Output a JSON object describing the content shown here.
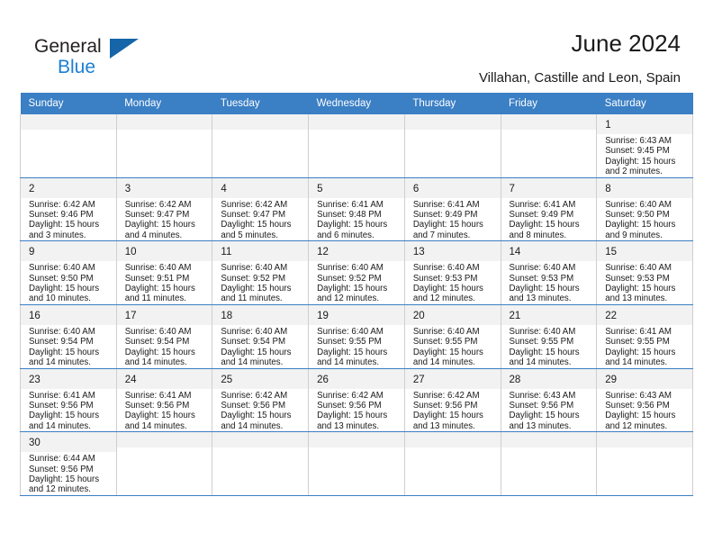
{
  "brand": {
    "name_top": "General",
    "name_bottom": "Blue",
    "accent_color": "#1b7fd4",
    "logo_triangle_color": "#1565a8"
  },
  "header": {
    "title": "June 2024",
    "subtitle": "Villahan, Castille and Leon, Spain"
  },
  "theme": {
    "header_row_bg": "#3b7fc4",
    "day_number_bg": "#f2f2f2",
    "grid_line": "#cfcfcf"
  },
  "weekdays": [
    "Sunday",
    "Monday",
    "Tuesday",
    "Wednesday",
    "Thursday",
    "Friday",
    "Saturday"
  ],
  "weeks": [
    [
      {
        "day": "",
        "sunrise": "",
        "sunset": "",
        "daylight": "",
        "empty": true
      },
      {
        "day": "",
        "sunrise": "",
        "sunset": "",
        "daylight": "",
        "empty": true
      },
      {
        "day": "",
        "sunrise": "",
        "sunset": "",
        "daylight": "",
        "empty": true
      },
      {
        "day": "",
        "sunrise": "",
        "sunset": "",
        "daylight": "",
        "empty": true
      },
      {
        "day": "",
        "sunrise": "",
        "sunset": "",
        "daylight": "",
        "empty": true
      },
      {
        "day": "",
        "sunrise": "",
        "sunset": "",
        "daylight": "",
        "empty": true
      },
      {
        "day": "1",
        "sunrise": "Sunrise: 6:43 AM",
        "sunset": "Sunset: 9:45 PM",
        "daylight": "Daylight: 15 hours and 2 minutes.",
        "empty": false
      }
    ],
    [
      {
        "day": "2",
        "sunrise": "Sunrise: 6:42 AM",
        "sunset": "Sunset: 9:46 PM",
        "daylight": "Daylight: 15 hours and 3 minutes.",
        "empty": false
      },
      {
        "day": "3",
        "sunrise": "Sunrise: 6:42 AM",
        "sunset": "Sunset: 9:47 PM",
        "daylight": "Daylight: 15 hours and 4 minutes.",
        "empty": false
      },
      {
        "day": "4",
        "sunrise": "Sunrise: 6:42 AM",
        "sunset": "Sunset: 9:47 PM",
        "daylight": "Daylight: 15 hours and 5 minutes.",
        "empty": false
      },
      {
        "day": "5",
        "sunrise": "Sunrise: 6:41 AM",
        "sunset": "Sunset: 9:48 PM",
        "daylight": "Daylight: 15 hours and 6 minutes.",
        "empty": false
      },
      {
        "day": "6",
        "sunrise": "Sunrise: 6:41 AM",
        "sunset": "Sunset: 9:49 PM",
        "daylight": "Daylight: 15 hours and 7 minutes.",
        "empty": false
      },
      {
        "day": "7",
        "sunrise": "Sunrise: 6:41 AM",
        "sunset": "Sunset: 9:49 PM",
        "daylight": "Daylight: 15 hours and 8 minutes.",
        "empty": false
      },
      {
        "day": "8",
        "sunrise": "Sunrise: 6:40 AM",
        "sunset": "Sunset: 9:50 PM",
        "daylight": "Daylight: 15 hours and 9 minutes.",
        "empty": false
      }
    ],
    [
      {
        "day": "9",
        "sunrise": "Sunrise: 6:40 AM",
        "sunset": "Sunset: 9:50 PM",
        "daylight": "Daylight: 15 hours and 10 minutes.",
        "empty": false
      },
      {
        "day": "10",
        "sunrise": "Sunrise: 6:40 AM",
        "sunset": "Sunset: 9:51 PM",
        "daylight": "Daylight: 15 hours and 11 minutes.",
        "empty": false
      },
      {
        "day": "11",
        "sunrise": "Sunrise: 6:40 AM",
        "sunset": "Sunset: 9:52 PM",
        "daylight": "Daylight: 15 hours and 11 minutes.",
        "empty": false
      },
      {
        "day": "12",
        "sunrise": "Sunrise: 6:40 AM",
        "sunset": "Sunset: 9:52 PM",
        "daylight": "Daylight: 15 hours and 12 minutes.",
        "empty": false
      },
      {
        "day": "13",
        "sunrise": "Sunrise: 6:40 AM",
        "sunset": "Sunset: 9:53 PM",
        "daylight": "Daylight: 15 hours and 12 minutes.",
        "empty": false
      },
      {
        "day": "14",
        "sunrise": "Sunrise: 6:40 AM",
        "sunset": "Sunset: 9:53 PM",
        "daylight": "Daylight: 15 hours and 13 minutes.",
        "empty": false
      },
      {
        "day": "15",
        "sunrise": "Sunrise: 6:40 AM",
        "sunset": "Sunset: 9:53 PM",
        "daylight": "Daylight: 15 hours and 13 minutes.",
        "empty": false
      }
    ],
    [
      {
        "day": "16",
        "sunrise": "Sunrise: 6:40 AM",
        "sunset": "Sunset: 9:54 PM",
        "daylight": "Daylight: 15 hours and 14 minutes.",
        "empty": false
      },
      {
        "day": "17",
        "sunrise": "Sunrise: 6:40 AM",
        "sunset": "Sunset: 9:54 PM",
        "daylight": "Daylight: 15 hours and 14 minutes.",
        "empty": false
      },
      {
        "day": "18",
        "sunrise": "Sunrise: 6:40 AM",
        "sunset": "Sunset: 9:54 PM",
        "daylight": "Daylight: 15 hours and 14 minutes.",
        "empty": false
      },
      {
        "day": "19",
        "sunrise": "Sunrise: 6:40 AM",
        "sunset": "Sunset: 9:55 PM",
        "daylight": "Daylight: 15 hours and 14 minutes.",
        "empty": false
      },
      {
        "day": "20",
        "sunrise": "Sunrise: 6:40 AM",
        "sunset": "Sunset: 9:55 PM",
        "daylight": "Daylight: 15 hours and 14 minutes.",
        "empty": false
      },
      {
        "day": "21",
        "sunrise": "Sunrise: 6:40 AM",
        "sunset": "Sunset: 9:55 PM",
        "daylight": "Daylight: 15 hours and 14 minutes.",
        "empty": false
      },
      {
        "day": "22",
        "sunrise": "Sunrise: 6:41 AM",
        "sunset": "Sunset: 9:55 PM",
        "daylight": "Daylight: 15 hours and 14 minutes.",
        "empty": false
      }
    ],
    [
      {
        "day": "23",
        "sunrise": "Sunrise: 6:41 AM",
        "sunset": "Sunset: 9:56 PM",
        "daylight": "Daylight: 15 hours and 14 minutes.",
        "empty": false
      },
      {
        "day": "24",
        "sunrise": "Sunrise: 6:41 AM",
        "sunset": "Sunset: 9:56 PM",
        "daylight": "Daylight: 15 hours and 14 minutes.",
        "empty": false
      },
      {
        "day": "25",
        "sunrise": "Sunrise: 6:42 AM",
        "sunset": "Sunset: 9:56 PM",
        "daylight": "Daylight: 15 hours and 14 minutes.",
        "empty": false
      },
      {
        "day": "26",
        "sunrise": "Sunrise: 6:42 AM",
        "sunset": "Sunset: 9:56 PM",
        "daylight": "Daylight: 15 hours and 13 minutes.",
        "empty": false
      },
      {
        "day": "27",
        "sunrise": "Sunrise: 6:42 AM",
        "sunset": "Sunset: 9:56 PM",
        "daylight": "Daylight: 15 hours and 13 minutes.",
        "empty": false
      },
      {
        "day": "28",
        "sunrise": "Sunrise: 6:43 AM",
        "sunset": "Sunset: 9:56 PM",
        "daylight": "Daylight: 15 hours and 13 minutes.",
        "empty": false
      },
      {
        "day": "29",
        "sunrise": "Sunrise: 6:43 AM",
        "sunset": "Sunset: 9:56 PM",
        "daylight": "Daylight: 15 hours and 12 minutes.",
        "empty": false
      }
    ],
    [
      {
        "day": "30",
        "sunrise": "Sunrise: 6:44 AM",
        "sunset": "Sunset: 9:56 PM",
        "daylight": "Daylight: 15 hours and 12 minutes.",
        "empty": false
      },
      {
        "day": "",
        "sunrise": "",
        "sunset": "",
        "daylight": "",
        "empty": true
      },
      {
        "day": "",
        "sunrise": "",
        "sunset": "",
        "daylight": "",
        "empty": true
      },
      {
        "day": "",
        "sunrise": "",
        "sunset": "",
        "daylight": "",
        "empty": true
      },
      {
        "day": "",
        "sunrise": "",
        "sunset": "",
        "daylight": "",
        "empty": true
      },
      {
        "day": "",
        "sunrise": "",
        "sunset": "",
        "daylight": "",
        "empty": true
      },
      {
        "day": "",
        "sunrise": "",
        "sunset": "",
        "daylight": "",
        "empty": true
      }
    ]
  ]
}
